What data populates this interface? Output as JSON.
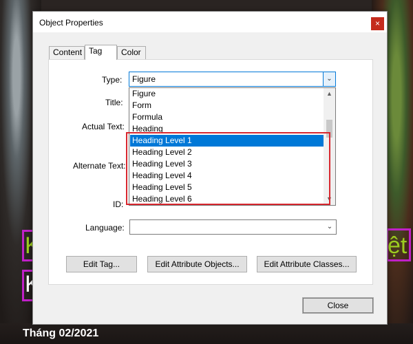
{
  "background": {
    "date_text": "Tháng 02/2021",
    "frame_color": "#c020c8",
    "line1_left": "K",
    "line1_right": "ệt",
    "line2_left": "K"
  },
  "dialog": {
    "title": "Object Properties",
    "close_glyph": "×",
    "tabs": [
      "Content",
      "Tag",
      "Color"
    ],
    "active_tab": "Tag",
    "labels": {
      "type": "Type:",
      "title": "Title:",
      "actual_text": "Actual Text:",
      "alternate_text": "Alternate Text:",
      "id": "ID:",
      "language": "Language:"
    },
    "type_value": "Figure",
    "language_value": "",
    "dropdown_options": [
      "Figure",
      "Form",
      "Formula",
      "Heading",
      "Heading Level 1",
      "Heading Level 2",
      "Heading Level 3",
      "Heading Level 4",
      "Heading Level 5",
      "Heading Level 6"
    ],
    "selected_option": "Heading Level 1",
    "buttons": {
      "edit_tag": "Edit Tag...",
      "edit_attribute_objects": "Edit Attribute Objects...",
      "edit_attribute_classes": "Edit Attribute Classes...",
      "close": "Close"
    },
    "highlight_color": "#d8262e",
    "accent_color": "#0078d7"
  }
}
